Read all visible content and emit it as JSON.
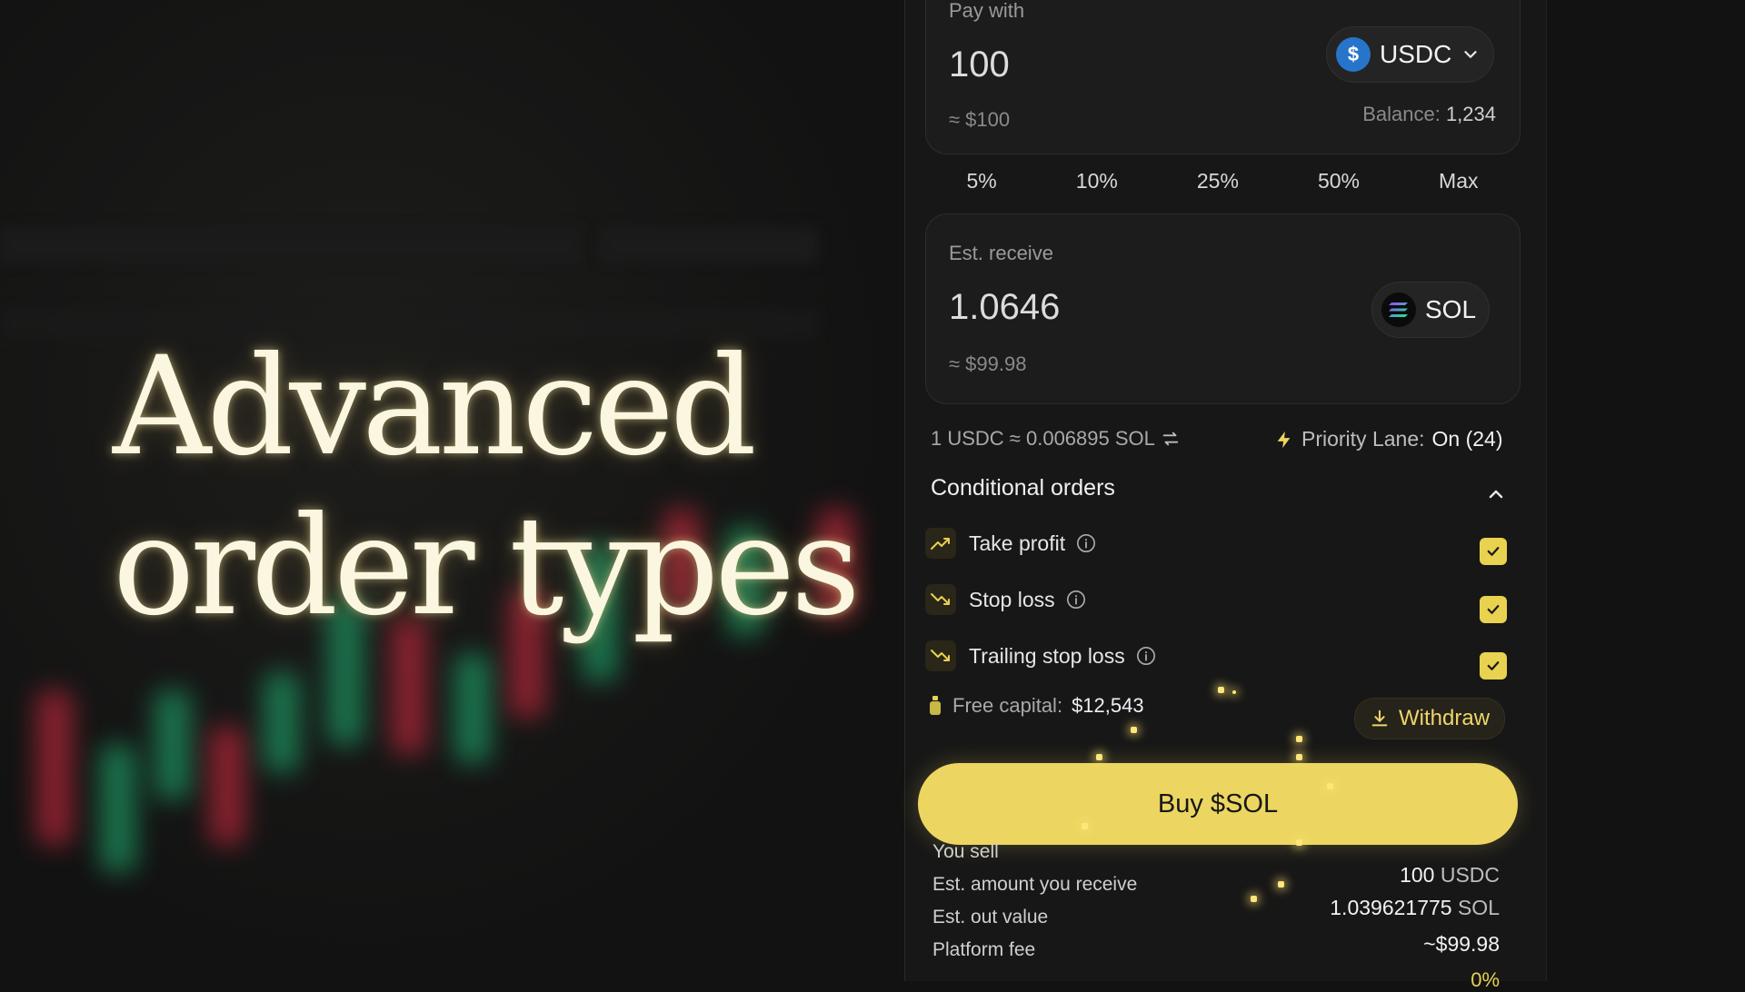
{
  "headline": {
    "line1": "Advanced",
    "line2": "order types"
  },
  "pay": {
    "label": "Pay with",
    "amount": "100",
    "approx": "≈ $100",
    "token": "USDC",
    "balance_label": "Balance:",
    "balance_value": "1,234"
  },
  "presets": [
    "5%",
    "10%",
    "25%",
    "50%",
    "Max"
  ],
  "receive": {
    "label": "Est. receive",
    "amount": "1.0646",
    "approx": "≈ $99.98",
    "token": "SOL"
  },
  "rate": {
    "text": "1 USDC ≈ 0.006895 SOL"
  },
  "priority": {
    "label": "Priority Lane:",
    "value": "On (24)"
  },
  "conditional": {
    "title": "Conditional orders",
    "orders": [
      {
        "label": "Take profit",
        "checked": true
      },
      {
        "label": "Stop loss",
        "checked": true
      },
      {
        "label": "Trailing stop loss",
        "checked": true
      }
    ]
  },
  "capital": {
    "label": "Free capital:",
    "value": "$12,543",
    "withdraw_label": "Withdraw"
  },
  "buy": {
    "label": "Buy $SOL"
  },
  "summary": {
    "sell_label": "You sell",
    "sell_value": "100",
    "sell_unit": "USDC",
    "receive_label": "Est. amount you receive",
    "receive_value": "1.039621775",
    "receive_unit": "SOL",
    "out_label": "Est. out value",
    "out_value": "~$99.98",
    "fee_label": "Platform fee",
    "fee_value": "0%"
  },
  "colors": {
    "accent": "#ecd661",
    "background": "#121212",
    "panel": "#171717",
    "usdc": "#2775ca"
  }
}
